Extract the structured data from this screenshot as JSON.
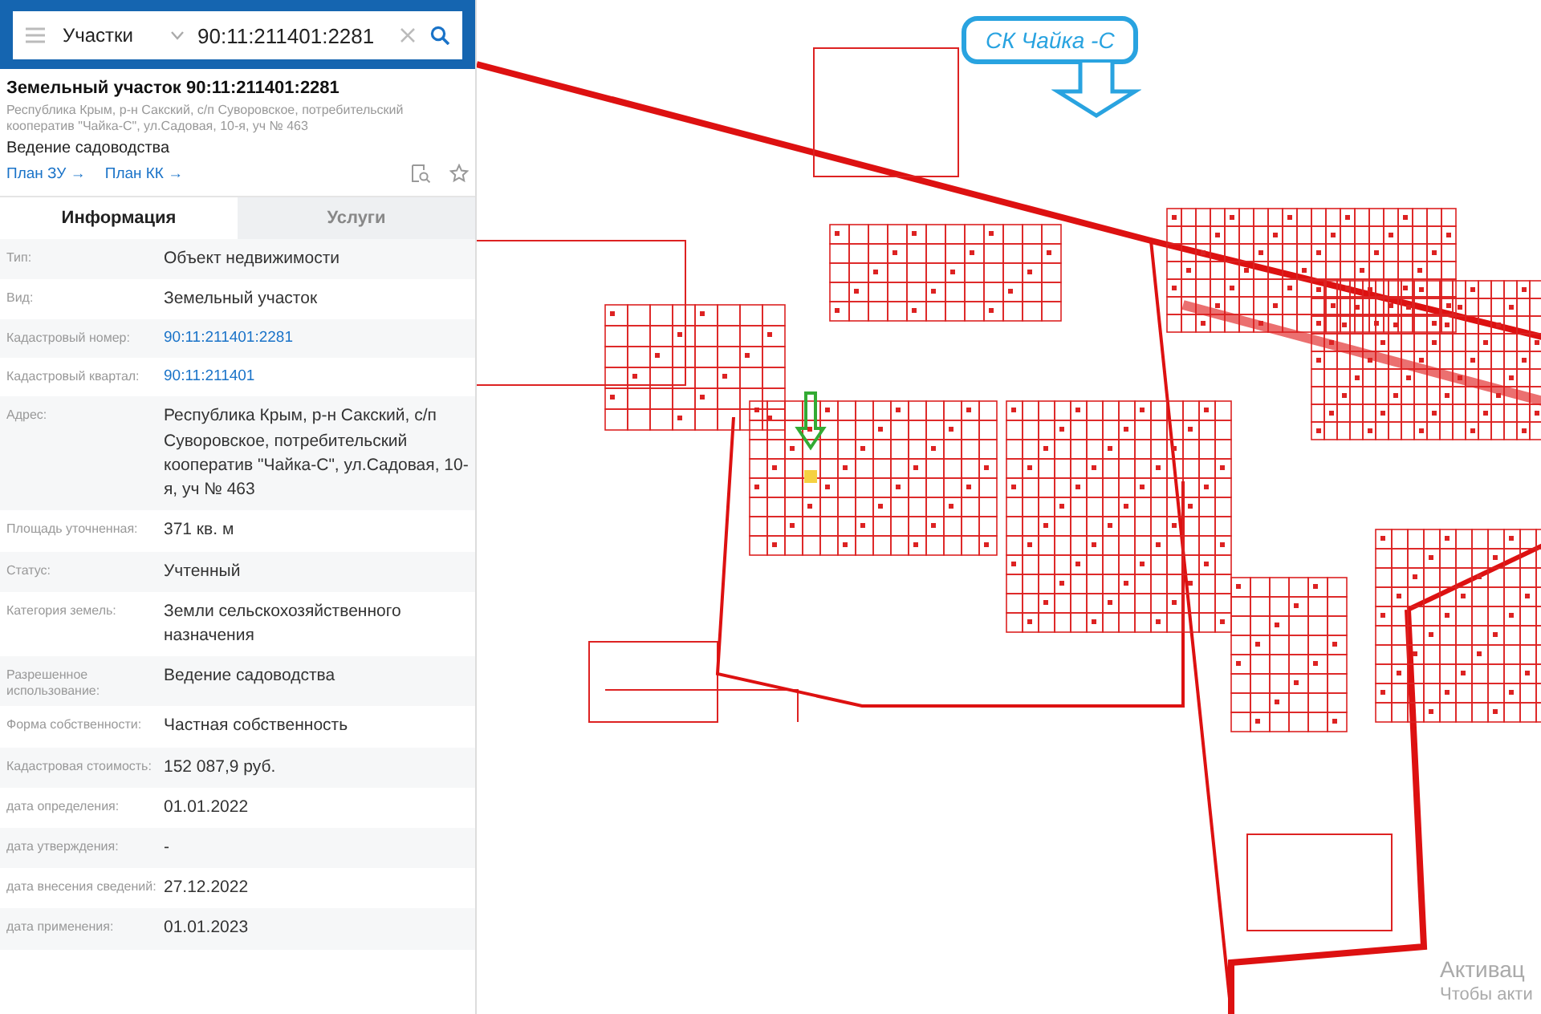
{
  "search": {
    "layer": "Участки",
    "value": "90:11:211401:2281"
  },
  "object": {
    "title": "Земельный участок 90:11:211401:2281",
    "address": "Республика Крым, р-н Сакский, с/п Суворовское, потребительский кооператив \"Чайка-С\", ул.Садовая, 10-я, уч № 463",
    "usage": "Ведение садоводства",
    "links": [
      "План ЗУ →",
      "План КК →"
    ]
  },
  "tabs": [
    {
      "label": "Информация",
      "selected": true
    },
    {
      "label": "Услуги",
      "selected": false
    }
  ],
  "rows": [
    {
      "label": "Тип:",
      "value": "Объект недвижимости",
      "kind": "text"
    },
    {
      "label": "Вид:",
      "value": "Земельный участок",
      "kind": "text"
    },
    {
      "label": "Кадастровый номер:",
      "value": "90:11:211401:2281",
      "kind": "link"
    },
    {
      "label": "Кадастровый квартал:",
      "value": "90:11:211401",
      "kind": "link"
    },
    {
      "label": "Адрес:",
      "value": "Республика Крым, р-н Сакский, с/п Суворовское, потребительский кооператив \"Чайка-С\", ул.Садовая, 10-я, уч № 463",
      "kind": "text"
    },
    {
      "label": "Площадь уточненная:",
      "value": "371 кв. м",
      "kind": "text"
    },
    {
      "label": "Статус:",
      "value": "Учтенный",
      "kind": "text"
    },
    {
      "label": "Категория земель:",
      "value": "Земли сельскохозяйственного назначения",
      "kind": "text"
    },
    {
      "label": "Разрешенное использование:",
      "value": "Ведение садоводства",
      "kind": "text"
    },
    {
      "label": "Форма собственности:",
      "value": "Частная собственность",
      "kind": "text"
    },
    {
      "label": "Кадастровая стоимость:",
      "value": "152 087,9 руб.",
      "kind": "text"
    },
    {
      "label": "дата определения:",
      "value": "01.01.2022",
      "kind": "text"
    },
    {
      "label": "дата утверждения:",
      "value": "-",
      "kind": "text"
    },
    {
      "label": "дата внесения сведений:",
      "value": "27.12.2022",
      "kind": "text"
    },
    {
      "label": "дата применения:",
      "value": "01.01.2023",
      "kind": "text"
    }
  ],
  "map": {
    "callout": "СК Чайка -С"
  },
  "activation": {
    "title": "Активац",
    "subtitle": "Чтобы акти"
  }
}
